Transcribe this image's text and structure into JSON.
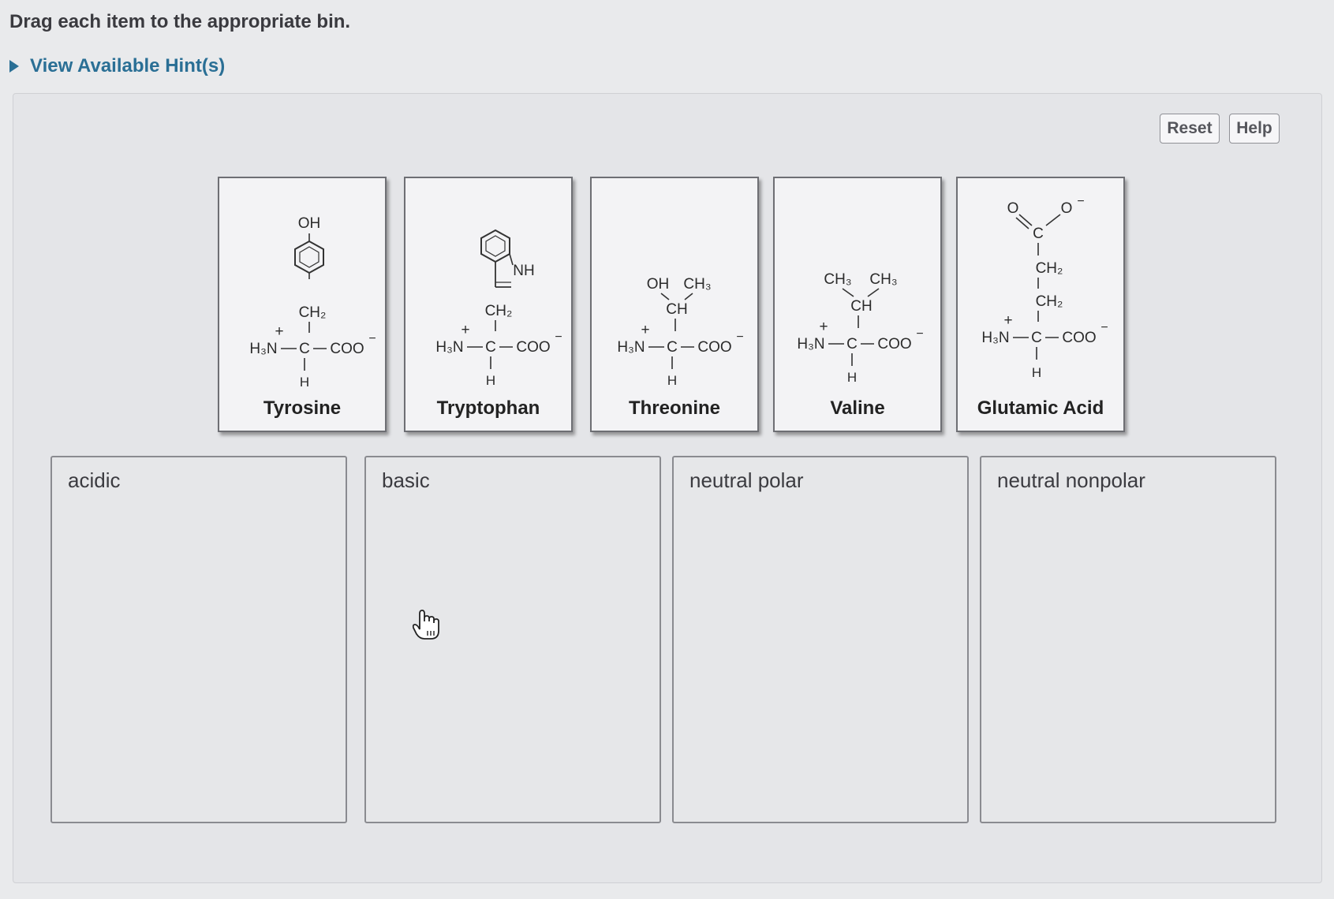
{
  "instruction": "Drag each item to the appropriate bin.",
  "hint_link": "View Available Hint(s)",
  "buttons": {
    "reset": "Reset",
    "help": "Help"
  },
  "cards": [
    {
      "name": "Tyrosine",
      "side_chain": "OH (phenol ring) – CH2"
    },
    {
      "name": "Tryptophan",
      "side_chain": "indole NH – CH2"
    },
    {
      "name": "Threonine",
      "side_chain": "OH CH3 – CH"
    },
    {
      "name": "Valine",
      "side_chain": "CH3 CH3 – CH"
    },
    {
      "name": "Glutamic Acid",
      "side_chain": "O O- C – CH2 – CH2"
    }
  ],
  "backbone": {
    "amine": "H3N",
    "charge_plus": "+",
    "carbon": "C",
    "carboxylate": "COO",
    "charge_minus": "−",
    "hydrogen": "H"
  },
  "bins": [
    {
      "label": "acidic"
    },
    {
      "label": "basic"
    },
    {
      "label": "neutral polar"
    },
    {
      "label": "neutral nonpolar"
    }
  ]
}
